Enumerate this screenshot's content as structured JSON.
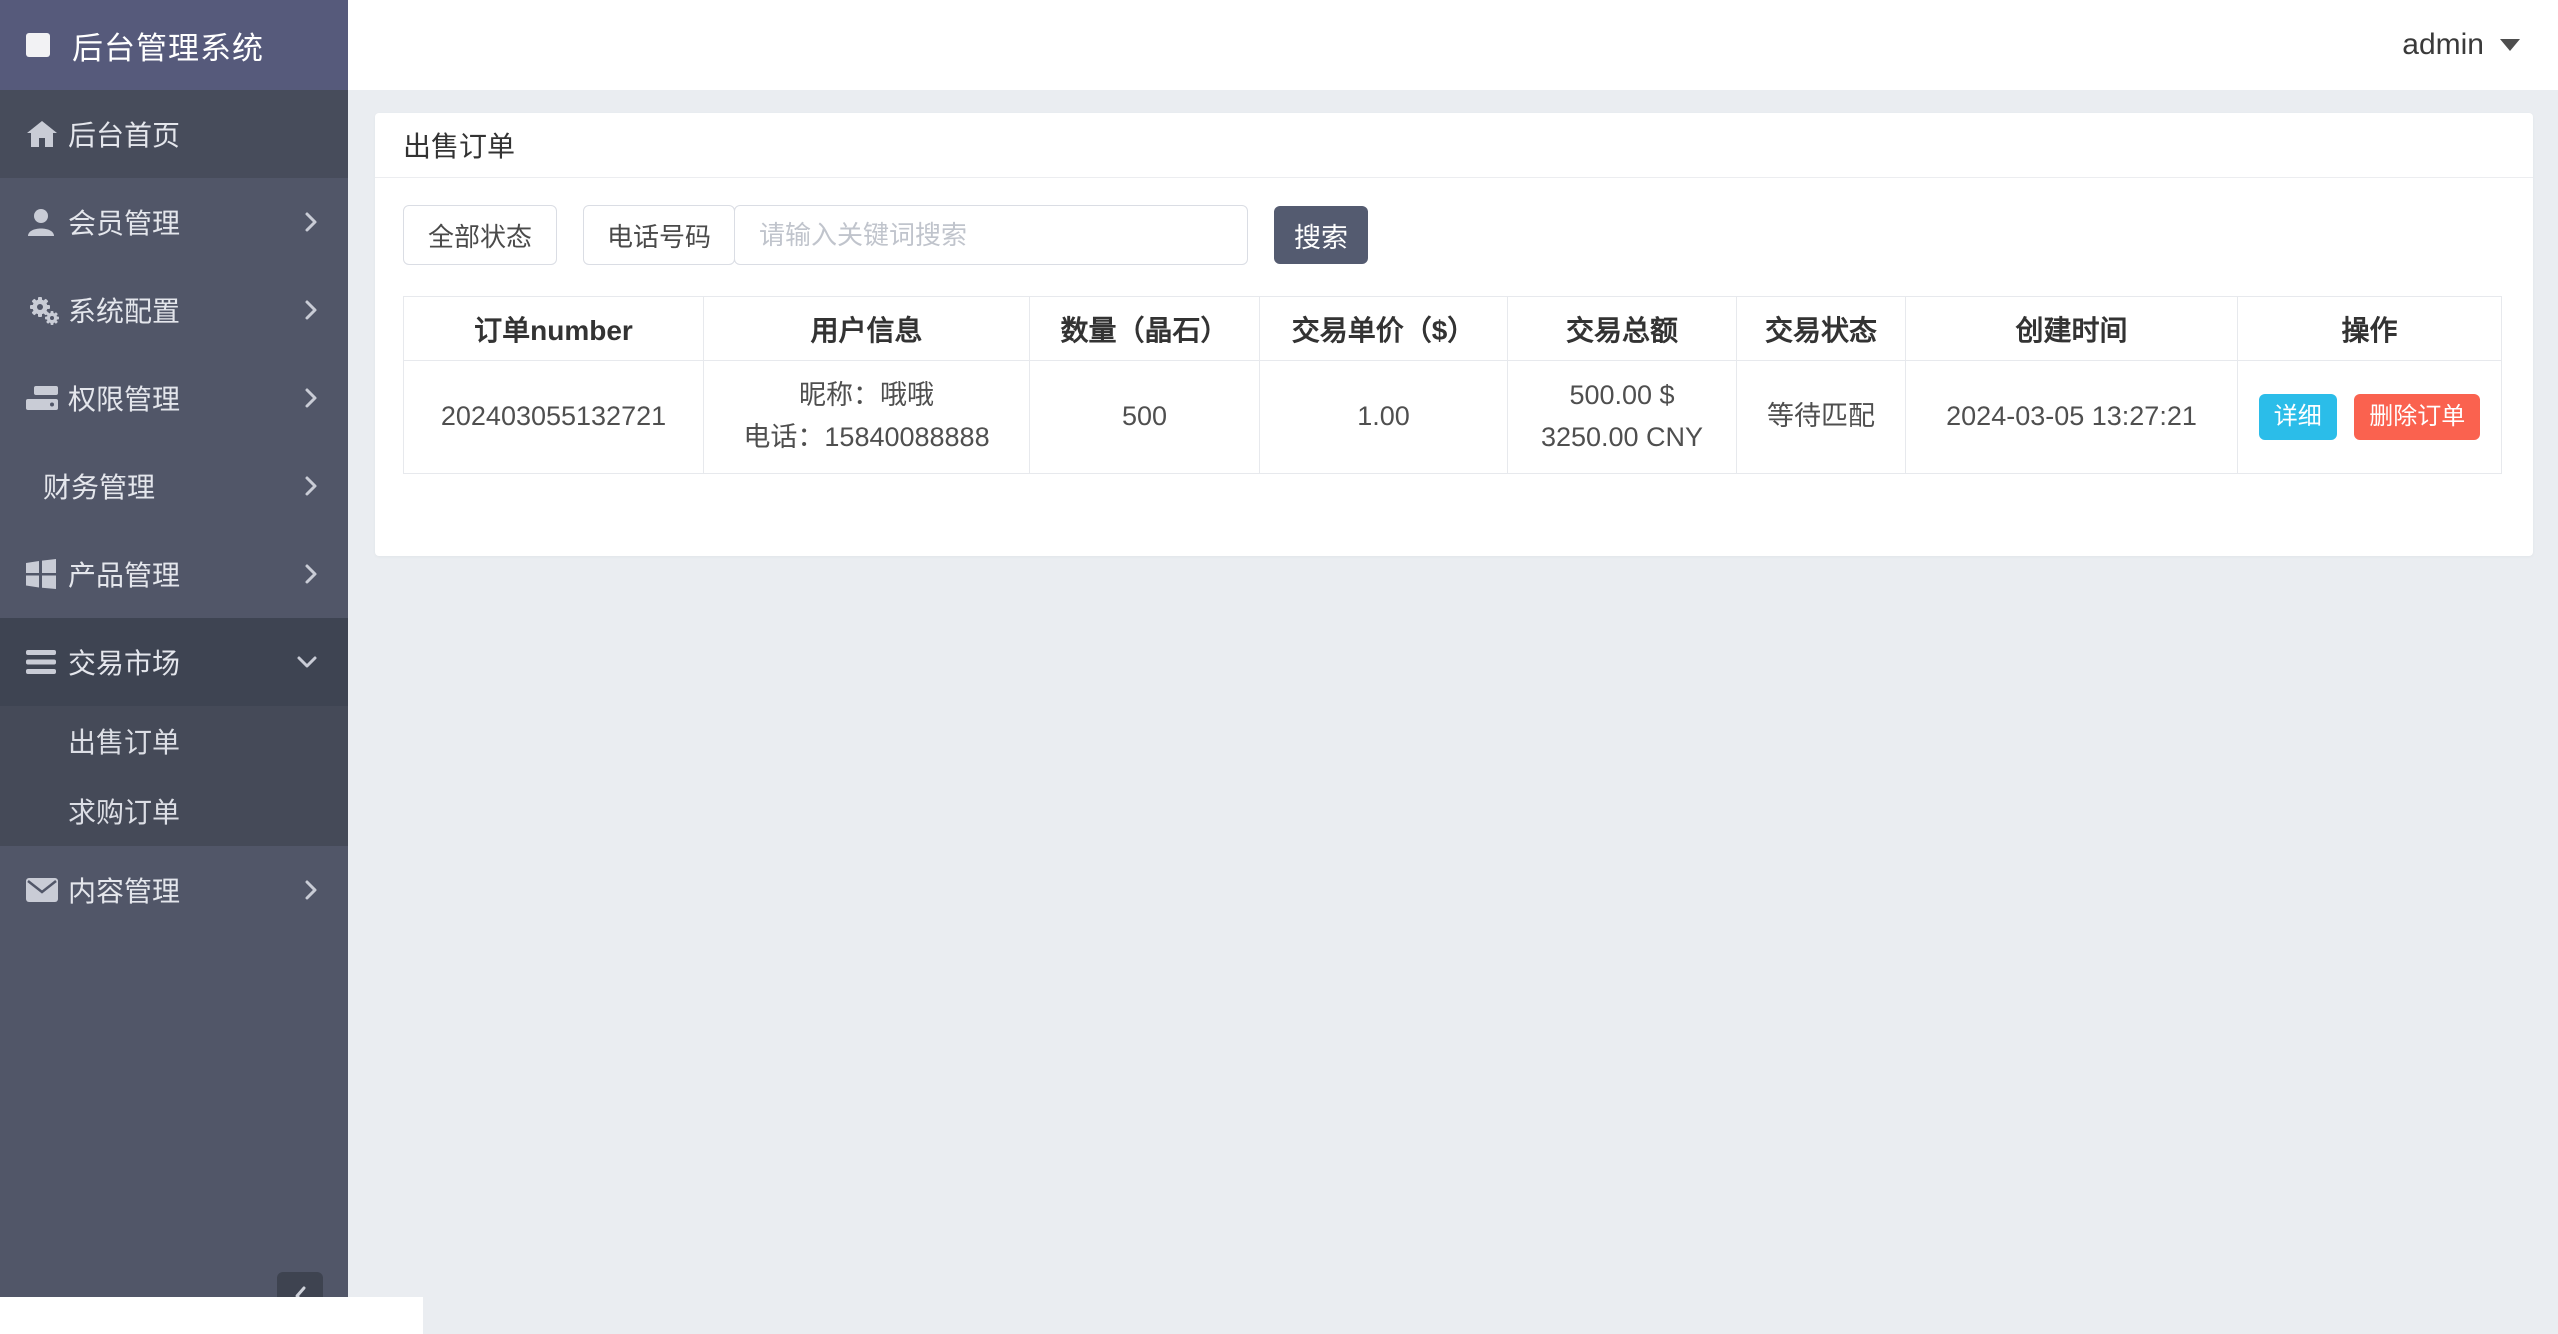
{
  "app": {
    "title": "后台管理系统"
  },
  "topbar": {
    "username": "admin"
  },
  "sidebar": {
    "items": [
      {
        "label": "后台首页",
        "icon": "home-icon"
      },
      {
        "label": "会员管理",
        "icon": "user-icon"
      },
      {
        "label": "系统配置",
        "icon": "gears-icon"
      },
      {
        "label": "权限管理",
        "icon": "server-icon"
      },
      {
        "label": "财务管理",
        "icon": ""
      },
      {
        "label": "产品管理",
        "icon": "grid-icon"
      },
      {
        "label": "交易市场",
        "icon": "bars-icon",
        "expanded": true,
        "children": [
          {
            "label": "出售订单",
            "active": true
          },
          {
            "label": "求购订单",
            "active": false
          }
        ]
      },
      {
        "label": "内容管理",
        "icon": "envelope-icon"
      }
    ]
  },
  "page": {
    "title": "出售订单"
  },
  "filters": {
    "status_select": "全部状态",
    "field_select": "电话号码",
    "keyword_placeholder": "请输入关键词搜索",
    "search_button": "搜索"
  },
  "table": {
    "columns": [
      "订单number",
      "用户信息",
      "数量（晶石）",
      "交易单价（$）",
      "交易总额",
      "交易状态",
      "创建时间",
      "操作"
    ],
    "rows": [
      {
        "order_number": "202403055132721",
        "user_info_line1": "昵称：哦哦",
        "user_info_line2": "电话：15840088888",
        "quantity": "500",
        "unit_price": "1.00",
        "total_line1": "500.00 $",
        "total_line2": "3250.00 CNY",
        "status": "等待匹配",
        "created_at": "2024-03-05 13:27:21",
        "action_detail": "详细",
        "action_delete": "删除订单"
      }
    ]
  },
  "colors": {
    "sidebar_bg": "#515668",
    "sidebar_header_bg": "#565A7B",
    "sidebar_group_bg": "#3E4452",
    "page_bg": "#EAEDF1",
    "search_button_bg": "#545B70",
    "accent_cyan": "#2BBDE9",
    "danger_red": "#FA624F"
  }
}
